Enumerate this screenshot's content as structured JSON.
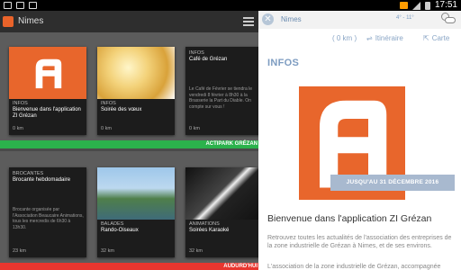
{
  "status_bar": {
    "time": "17:51"
  },
  "app": {
    "title": "Nimes",
    "section1_cards": [
      {
        "category": "INFOS",
        "title": "Bienvenue dans l'application ZI Grézan",
        "desc": "",
        "distance": "0 km",
        "image": "zi-grezan-logo"
      },
      {
        "category": "INFOS",
        "title": "Soirée des vœux",
        "desc": "",
        "distance": "0 km",
        "image": "champagne-glasses"
      },
      {
        "category": "INFOS",
        "title": "Café de Grézan",
        "desc": "Le Café de Février se tiendra le vendredi 8 février à 8h30 à la Brasserie la Part du Diable. On compte sur vous !",
        "distance": "0 km",
        "image": "none"
      }
    ],
    "band1_label": "ACTIPARK GRÉZAN",
    "band1_color": "#2bb24c",
    "section2_cards": [
      {
        "category": "BROCANTES",
        "title": "Brocante hebdomadaire",
        "desc": "Brocante organisée par l'Association Beaucaire Animations, tous les mercredis de 6h30 à 13h30.",
        "distance": "23 km",
        "image": "none"
      },
      {
        "category": "BALADES",
        "title": "Rando-Oiseaux",
        "desc": "",
        "distance": "32 km",
        "image": "boat-birdwatching"
      },
      {
        "category": "ANIMATIONS",
        "title": "Soirées Karaoké",
        "desc": "",
        "distance": "32 km",
        "image": "microphone"
      }
    ],
    "band2_label": "AUDURD'HUI",
    "band2_color": "#e9362f",
    "accent": "#e8662c"
  },
  "panel": {
    "city": "Nimes",
    "temp": "4° - 11°",
    "distance": "( 0 km )",
    "itinerary": "Itinéraire",
    "map": "Carte",
    "category": "INFOS",
    "date_banner": "JUSQU'AU 31 DÉCEMBRE 2016",
    "title": "Bienvenue dans l'application ZI Grézan",
    "text": "Retrouvez toutes les actualités de l'association des entreprises de la zone industrielle de Grézan à Nimes, et de ses environs.",
    "text2": "L'association de la zone industrielle de Grézan, accompagnée",
    "accent": "#7d9cc1"
  }
}
